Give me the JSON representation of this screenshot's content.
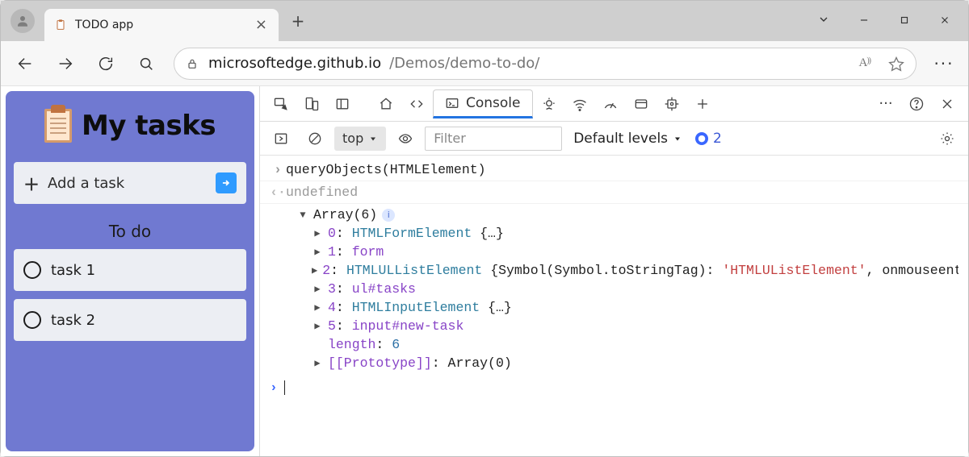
{
  "window": {
    "tab_title": "TODO app",
    "win_minimize": "—",
    "win_maximize": "▢",
    "win_close": "✕"
  },
  "addr": {
    "url_primary": "microsoftedge.github.io",
    "url_secondary": "/Demos/demo-to-do/"
  },
  "app": {
    "title": "My tasks",
    "add_label": "Add a task",
    "section": "To do",
    "tasks": [
      "task 1",
      "task 2"
    ]
  },
  "devtools": {
    "tabs": {
      "console_label": "Console"
    },
    "context": "top",
    "filter_placeholder": "Filter",
    "levels": "Default levels",
    "issues_count": "2"
  },
  "console": {
    "input": "queryObjects(HTMLElement)",
    "return": "undefined",
    "array_header": "Array(6)",
    "lines": {
      "l0_idx": "0",
      "l0_type": "HTMLFormElement",
      "l0_tail": " {…}",
      "l1_idx": "1",
      "l1_val": "form",
      "l2_idx": "2",
      "l2_type": "HTMLULListElement",
      "l2_propkey": "{Symbol(Symbol.toStringTag):",
      "l2_str": "'HTMLUListElement'",
      "l2_tail": ", onmouseenter:",
      "l3_idx": "3",
      "l3_val": "ul#tasks",
      "l4_idx": "4",
      "l4_type": "HTMLInputElement",
      "l4_tail": " {…}",
      "l5_idx": "5",
      "l5_val": "input#new-task",
      "length_key": "length",
      "length_val": "6",
      "proto": "[[Prototype]]",
      "proto_val": "Array(0)"
    }
  }
}
